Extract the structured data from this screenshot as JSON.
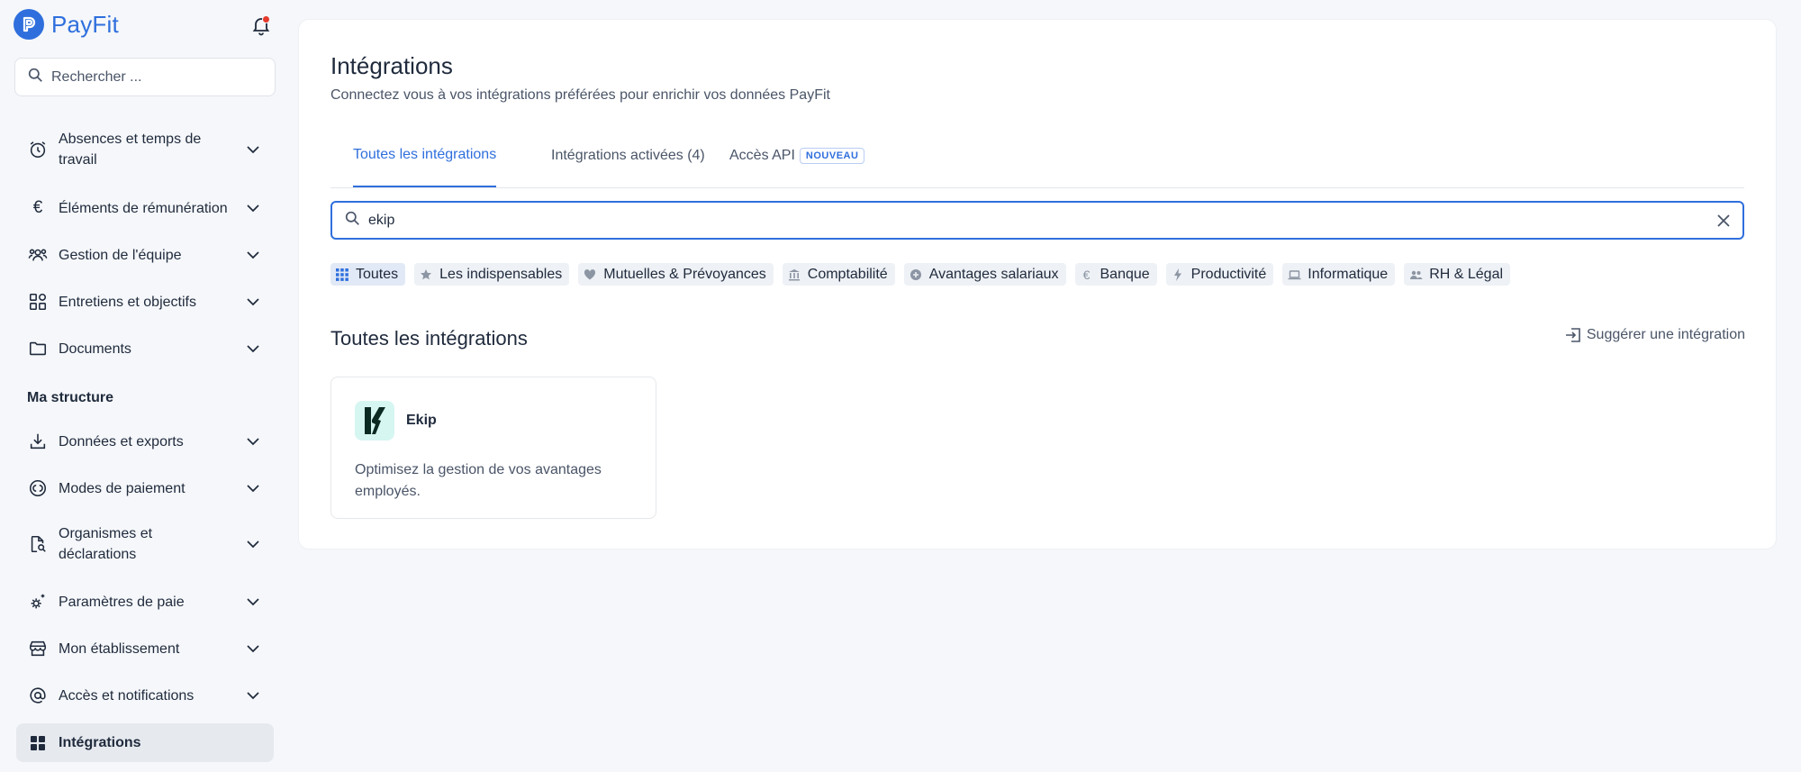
{
  "brand": {
    "name": "PayFit"
  },
  "sidebar": {
    "search_placeholder": "Rechercher ...",
    "items": [
      {
        "label": "Absences et temps de travail",
        "icon": "alarm-clock-icon"
      },
      {
        "label": "Éléments de rémunération",
        "icon": "euro-icon"
      },
      {
        "label": "Gestion de l'équipe",
        "icon": "team-icon"
      },
      {
        "label": "Entretiens et objectifs",
        "icon": "shapes-icon"
      },
      {
        "label": "Documents",
        "icon": "folder-icon"
      }
    ],
    "section_label": "Ma structure",
    "structure_items": [
      {
        "label": "Données et exports",
        "icon": "download-icon"
      },
      {
        "label": "Modes de paiement",
        "icon": "coins-icon"
      },
      {
        "label": "Organismes et déclarations",
        "icon": "document-search-icon"
      },
      {
        "label": "Paramètres de paie",
        "icon": "settings-sparkle-icon"
      },
      {
        "label": "Mon établissement",
        "icon": "storefront-icon"
      },
      {
        "label": "Accès et notifications",
        "icon": "at-sign-icon"
      },
      {
        "label": "Intégrations",
        "icon": "grid-icon",
        "active": true
      }
    ]
  },
  "main": {
    "title": "Intégrations",
    "subtitle": "Connectez vous à vos intégrations préférées pour enrichir vos données PayFit",
    "tabs": [
      {
        "label": "Toutes les intégrations",
        "active": true
      },
      {
        "label": "Intégrations activées (4)"
      },
      {
        "label": "Accès API",
        "badge": "NOUVEAU"
      }
    ],
    "search": {
      "value": "ekip"
    },
    "categories": [
      {
        "label": "Toutes",
        "icon": "grid-icon",
        "active": true
      },
      {
        "label": "Les indispensables",
        "icon": "star-icon"
      },
      {
        "label": "Mutuelles & Prévoyances",
        "icon": "heart-icon"
      },
      {
        "label": "Comptabilité",
        "icon": "bank-icon"
      },
      {
        "label": "Avantages salariaux",
        "icon": "plus-circle-icon"
      },
      {
        "label": "Banque",
        "icon": "euro-icon"
      },
      {
        "label": "Productivité",
        "icon": "lightning-icon"
      },
      {
        "label": "Informatique",
        "icon": "laptop-icon"
      },
      {
        "label": "RH & Légal",
        "icon": "people-icon"
      }
    ],
    "section_title": "Toutes les intégrations",
    "suggest_label": "Suggérer une intégration",
    "results": [
      {
        "name": "Ekip",
        "description": "Optimisez la gestion de vos avantages employés.",
        "logo": "ekip-logo"
      }
    ]
  },
  "colors": {
    "accent": "#2f6fdd",
    "notification": "#e5392c",
    "ekip_bg": "#d6f6f2",
    "ekip_mark": "#0b2a22"
  }
}
